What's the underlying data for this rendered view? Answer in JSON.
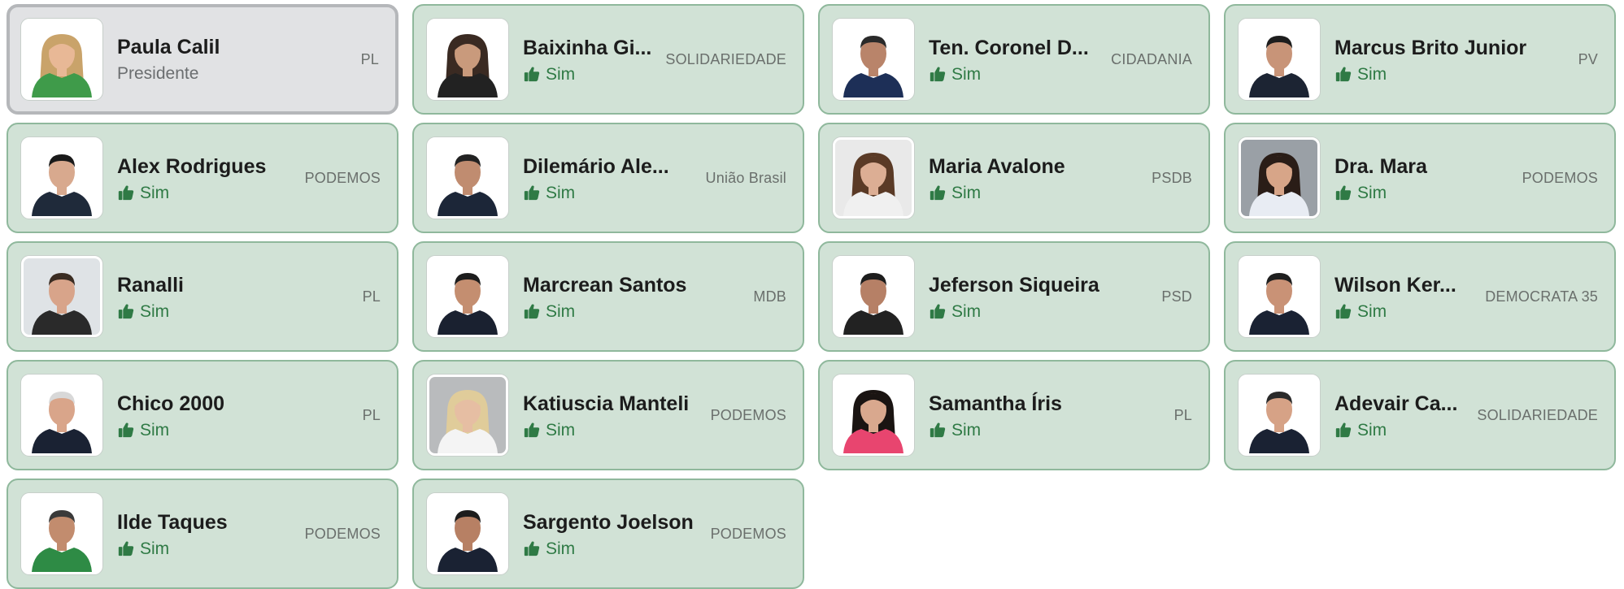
{
  "members": [
    {
      "name": "Paula Calil",
      "role": "Presidente",
      "party": "PL",
      "president": true,
      "avatar": {
        "bg": "#ffffff",
        "skin": "#e8b896",
        "hair": "#c9a36a",
        "shirt": "#3f9b4a",
        "long_hair": true
      }
    },
    {
      "name": "Baixinha Gi...",
      "vote": "Sim",
      "party": "SOLIDARIEDADE",
      "avatar": {
        "bg": "#ffffff",
        "skin": "#c99a7c",
        "hair": "#3a2a22",
        "shirt": "#222222",
        "long_hair": true
      }
    },
    {
      "name": "Ten. Coronel D...",
      "vote": "Sim",
      "party": "CIDADANIA",
      "avatar": {
        "bg": "#ffffff",
        "skin": "#b9846a",
        "hair": "#2a2a2a",
        "shirt": "#1d2f57",
        "long_hair": false
      }
    },
    {
      "name": "Marcus Brito Junior",
      "vote": "Sim",
      "party": "PV",
      "avatar": {
        "bg": "#ffffff",
        "skin": "#c89478",
        "hair": "#1d1d1d",
        "shirt": "#1c2433",
        "long_hair": false
      }
    },
    {
      "name": "Alex Rodrigues",
      "vote": "Sim",
      "party": "PODEMOS",
      "avatar": {
        "bg": "#ffffff",
        "skin": "#d8a98e",
        "hair": "#1a1a1a",
        "shirt": "#1f2a3a",
        "long_hair": false
      }
    },
    {
      "name": "Dilemário Ale...",
      "vote": "Sim",
      "party": "União Brasil",
      "avatar": {
        "bg": "#ffffff",
        "skin": "#c08c70",
        "hair": "#222222",
        "shirt": "#1c2638",
        "long_hair": false
      }
    },
    {
      "name": "Maria Avalone",
      "vote": "Sim",
      "party": "PSDB",
      "avatar": {
        "bg": "#e9e9e9",
        "skin": "#dcae94",
        "hair": "#5a3a26",
        "shirt": "#f0f0f0",
        "long_hair": true
      }
    },
    {
      "name": "Dra. Mara",
      "vote": "Sim",
      "party": "PODEMOS",
      "avatar": {
        "bg": "#9aa0a6",
        "skin": "#d7a588",
        "hair": "#2a1d17",
        "shirt": "#e8ecf3",
        "long_hair": true
      }
    },
    {
      "name": "Ranalli",
      "vote": "Sim",
      "party": "PL",
      "avatar": {
        "bg": "#dfe3e6",
        "skin": "#d8a48a",
        "hair": "#3a2c22",
        "shirt": "#2a2a2a",
        "long_hair": false
      }
    },
    {
      "name": "Marcrean Santos",
      "vote": "Sim",
      "party": "MDB",
      "avatar": {
        "bg": "#ffffff",
        "skin": "#c48e70",
        "hair": "#1d1d1d",
        "shirt": "#1a2130",
        "long_hair": false
      }
    },
    {
      "name": "Jeferson Siqueira",
      "vote": "Sim",
      "party": "PSD",
      "avatar": {
        "bg": "#ffffff",
        "skin": "#b68066",
        "hair": "#1d1d1d",
        "shirt": "#222222",
        "long_hair": false
      }
    },
    {
      "name": "Wilson Ker...",
      "vote": "Sim",
      "party": "DEMOCRATA 35",
      "avatar": {
        "bg": "#ffffff",
        "skin": "#c99276",
        "hair": "#1f1f1f",
        "shirt": "#1a2233",
        "long_hair": false
      }
    },
    {
      "name": "Chico 2000",
      "vote": "Sim",
      "party": "PL",
      "avatar": {
        "bg": "#ffffff",
        "skin": "#d9a58a",
        "hair": "#d8d8d8",
        "shirt": "#1a2233",
        "long_hair": false
      }
    },
    {
      "name": "Katiuscia Manteli",
      "vote": "Sim",
      "party": "PODEMOS",
      "avatar": {
        "bg": "#b9bbbd",
        "skin": "#e6bea3",
        "hair": "#e0cc9a",
        "shirt": "#f4f4f4",
        "long_hair": true
      }
    },
    {
      "name": "Samantha Íris",
      "vote": "Sim",
      "party": "PL",
      "avatar": {
        "bg": "#ffffff",
        "skin": "#d9a88e",
        "hair": "#1a1412",
        "shirt": "#e8456f",
        "long_hair": true
      }
    },
    {
      "name": "Adevair Ca...",
      "vote": "Sim",
      "party": "SOLIDARIEDADE",
      "avatar": {
        "bg": "#ffffff",
        "skin": "#d6a286",
        "hair": "#2a2a2a",
        "shirt": "#1a2233",
        "long_hair": false
      }
    },
    {
      "name": "Ilde Taques",
      "vote": "Sim",
      "party": "PODEMOS",
      "avatar": {
        "bg": "#ffffff",
        "skin": "#c28c6e",
        "hair": "#3a3a3a",
        "shirt": "#2e8b45",
        "long_hair": false
      }
    },
    {
      "name": "Sargento Joelson",
      "vote": "Sim",
      "party": "PODEMOS",
      "avatar": {
        "bg": "#ffffff",
        "skin": "#b78064",
        "hair": "#1d1d1d",
        "shirt": "#1a2233",
        "long_hair": false
      }
    }
  ],
  "colors": {
    "card_bg": "#d1e2d6",
    "card_border": "#8fb89c",
    "president_bg": "#e1e2e4",
    "vote_green": "#2f7a45"
  },
  "icons": {
    "vote": "thumbs-up-icon"
  }
}
